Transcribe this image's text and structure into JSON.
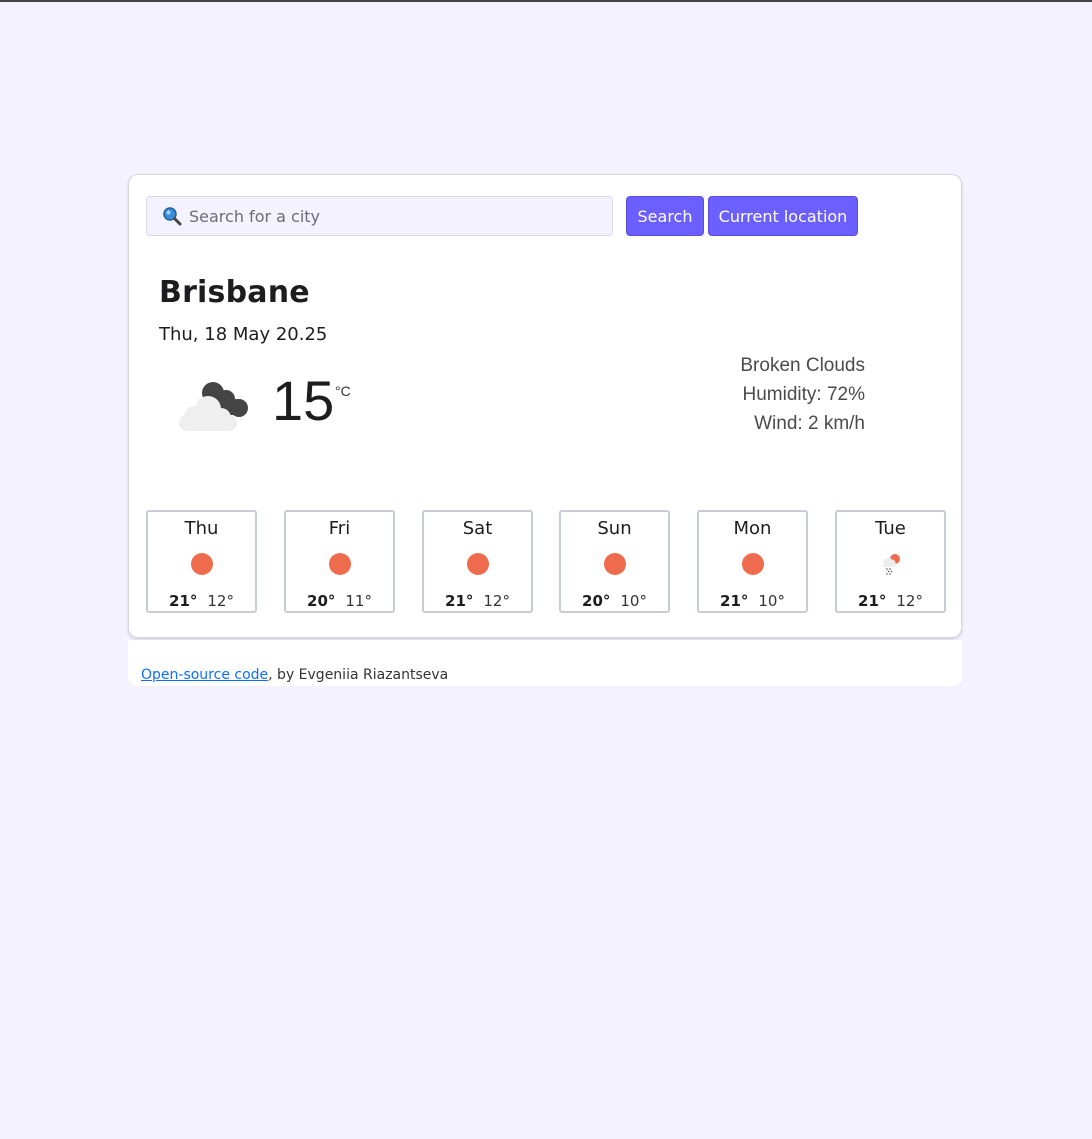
{
  "search": {
    "placeholder": "Search for a city",
    "search_label": "Search",
    "location_label": "Current location"
  },
  "current": {
    "city": "Brisbane",
    "date": "Thu, 18 May 20.25",
    "temperature": "15",
    "unit": "°C",
    "icon": "broken-clouds-icon",
    "description": "Broken Clouds",
    "humidity": "Humidity: 72%",
    "wind": "Wind: 2 km/h"
  },
  "forecast": [
    {
      "day": "Thu",
      "max": "21°",
      "min": "12°",
      "icon": "sun-icon"
    },
    {
      "day": "Fri",
      "max": "20°",
      "min": "11°",
      "icon": "sun-icon"
    },
    {
      "day": "Sat",
      "max": "21°",
      "min": "12°",
      "icon": "sun-icon"
    },
    {
      "day": "Sun",
      "max": "20°",
      "min": "10°",
      "icon": "sun-icon"
    },
    {
      "day": "Mon",
      "max": "21°",
      "min": "10°",
      "icon": "sun-icon"
    },
    {
      "day": "Tue",
      "max": "21°",
      "min": "12°",
      "icon": "rain-sun-icon"
    }
  ],
  "footer": {
    "link_text": "Open-source code",
    "suffix": ", by Evgeniia Riazantseva"
  },
  "colors": {
    "accent": "#6c5fff",
    "background": "#f4f2ff",
    "sun": "#ee6c4d",
    "link": "#0d6efd"
  }
}
